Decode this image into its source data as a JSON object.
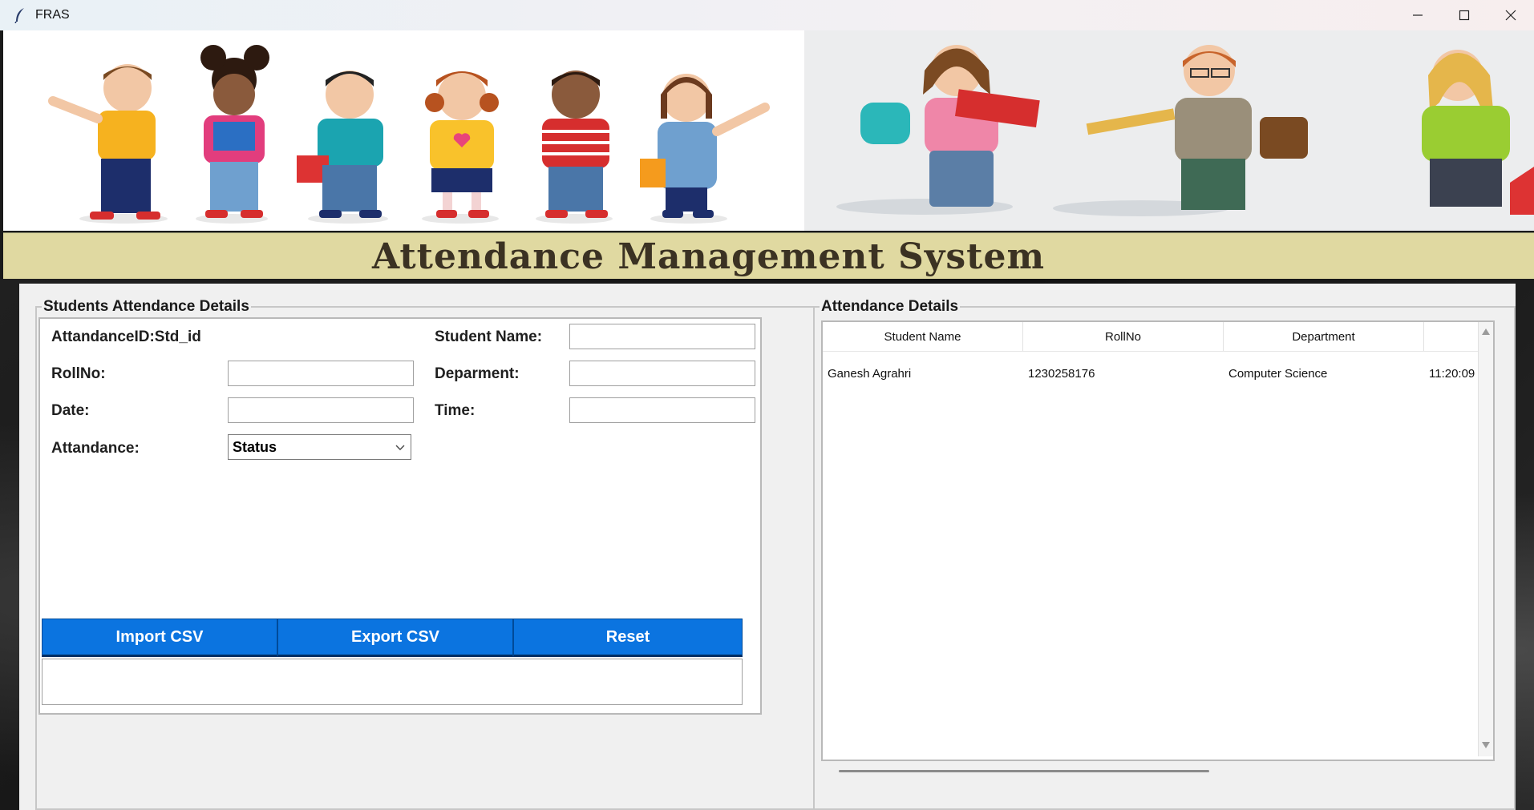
{
  "window": {
    "title": "FRAS",
    "controls": [
      "minimize-icon",
      "maximize-icon",
      "close-icon"
    ]
  },
  "banner": {
    "left_image": "children-with-backpacks-illustration",
    "right_image": "teachers-illustration"
  },
  "heading": {
    "text": "Attendance Management System"
  },
  "left_frame": {
    "legend": "Students Attendance Details",
    "fields": {
      "attendance_id_label": "AttandanceID:Std_id",
      "student_name_label": "Student Name:",
      "rollno_label": "RollNo:",
      "department_label": "Deparment:",
      "date_label": "Date:",
      "time_label": "Time:",
      "attendance_label": "Attandance:",
      "attendance_select_value": "Status"
    },
    "buttons": {
      "import": "Import CSV",
      "export": "Export CSV",
      "reset": "Reset"
    }
  },
  "right_frame": {
    "legend": "Attendance Details",
    "columns": [
      "Student Name",
      "RollNo",
      "Department",
      ""
    ],
    "rows": [
      [
        "Ganesh Agrahri",
        "1230258176",
        "Computer Science",
        "11:20:09"
      ]
    ]
  },
  "colors": {
    "button_blue": "#0b74e0",
    "heading_band": "#e0d9a1",
    "heading_text": "#3b3223"
  }
}
